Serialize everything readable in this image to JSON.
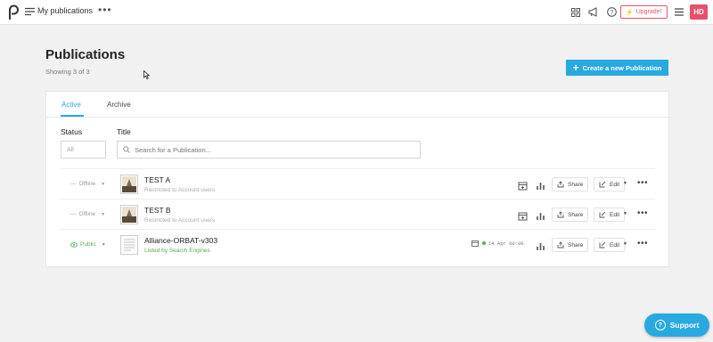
{
  "topbar": {
    "title": "My publications",
    "more": "•••",
    "upgrade_label": "Upgrade!",
    "avatar_initials": "HD"
  },
  "header": {
    "title": "Publications",
    "showing": "Showing 3 of 3",
    "create_button": "Create a new Publication"
  },
  "tabs": [
    "Active",
    "Archive"
  ],
  "filters": {
    "status_label": "Status",
    "status_value": "All",
    "title_label": "Title",
    "search_placeholder": "Search for a Publication..."
  },
  "rows": [
    {
      "status": "Offline",
      "title": "TEST A",
      "subtitle": "Restricted to Account users",
      "share": "Share",
      "edit": "Edit"
    },
    {
      "status": "Offline",
      "title": "TEST B",
      "subtitle": "Restricted to Account users",
      "share": "Share",
      "edit": "Edit"
    },
    {
      "status": "Public",
      "title": "Alliance-ORBAT-v303",
      "subtitle": "Listed by Search Engines",
      "schedule": "14 Apr 09:00",
      "share": "Share",
      "edit": "Edit"
    }
  ],
  "support_label": "Support",
  "colors": {
    "accent": "#28a9e0",
    "brand_red": "#e8506b",
    "public_green": "#5aa95a"
  }
}
